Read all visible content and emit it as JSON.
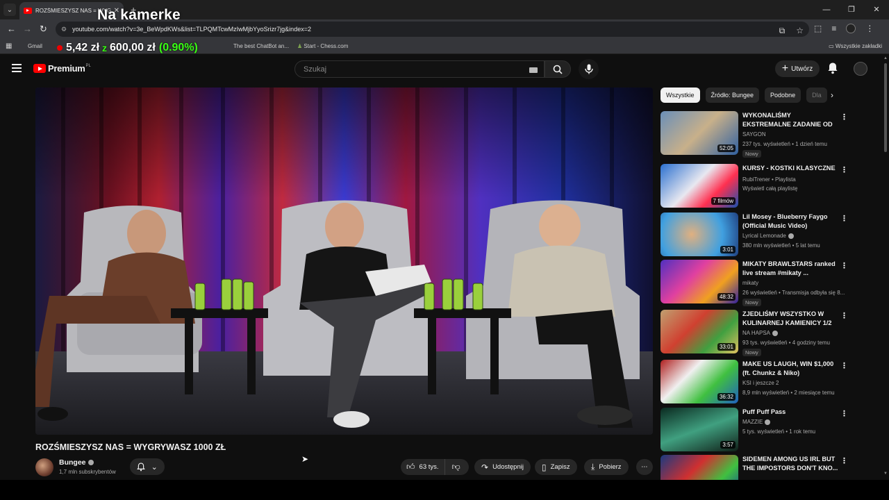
{
  "browser": {
    "tab_title": "ROZŚMIESZYSZ NAS = WYGRY...",
    "overlay_title": "Na kamerke",
    "url": "youtube.com/watch?v=3e_BeWpdKWs&list=TLPQMTcwMzIwMjbYyoSrizr7jg&index=2",
    "bookmarks": [
      "Gmail",
      "The best ChatBot an...",
      "Start - Chess.com"
    ],
    "all_bookmarks": "Wszystkie zakładki"
  },
  "ticker": {
    "amount": "5,42 zł",
    "of": "z",
    "goal": "600,00 zł",
    "percent": "(0.90%)"
  },
  "header": {
    "logo": "Premium",
    "logo_region": "PL",
    "search_placeholder": "Szukaj",
    "create_label": "Utwórz"
  },
  "video": {
    "title": "ROZŚMIESZYSZ NAS = WYGRYWASZ 1000 ZŁ",
    "channel": "Bungee",
    "subscribers": "1,7 mln subskrybentów",
    "likes": "63 tys.",
    "share": "Udostępnij",
    "save": "Zapisz",
    "download": "Pobierz"
  },
  "chips": [
    "Wszystkie",
    "Źródło: Bungee",
    "Podobne",
    "Dla"
  ],
  "recommendations": [
    {
      "title": "WYKONALIŚMY EKSTREMALNE ZADANIE OD BANDURY",
      "channel": "SAYGON",
      "meta": "237 tys. wyświetleń • 1 dzień temu",
      "badge": "Nowy",
      "duration": "52:05"
    },
    {
      "title": "KURSY - KOSTKI KLASYCZNE",
      "channel": "RubiTrener • Playlista",
      "meta": "Wyświetl całą playlistę",
      "badge": "",
      "duration": "7 filmów"
    },
    {
      "title": "Lil Mosey - Blueberry Faygo (Official Music Video)",
      "channel": "Lyrical Lemonade",
      "meta": "380 mln wyświetleń • 5 lat temu",
      "badge": "",
      "duration": "3:01"
    },
    {
      "title": "MIKATY BRAWLSTARS ranked live stream #mikaty ...",
      "channel": "mikaty",
      "meta": "26 wyświetleń • Transmisja odbyła się 8...",
      "badge": "Nowy",
      "duration": "48:32"
    },
    {
      "title": "ZJEDLIŚMY WSZYSTKO W KULINARNEJ KAMIENICY 1/2",
      "channel": "NA HAPSA",
      "meta": "93 tys. wyświetleń • 4 godziny temu",
      "badge": "Nowy",
      "duration": "33:01"
    },
    {
      "title": "MAKE US LAUGH, WIN $1,000 (ft. Chunkz & Niko)",
      "channel": "KSI i jeszcze 2",
      "meta": "8,9 mln wyświetleń • 2 miesiące temu",
      "badge": "",
      "duration": "36:32"
    },
    {
      "title": "Puff Puff Pass",
      "channel": "MAZZIE",
      "meta": "5 tys. wyświetleń • 1 rok temu",
      "badge": "",
      "duration": "3:57"
    },
    {
      "title": "SIDEMEN AMONG US IRL BUT THE IMPOSTORS DON'T KNO...",
      "channel": "",
      "meta": "",
      "badge": "",
      "duration": ""
    }
  ]
}
